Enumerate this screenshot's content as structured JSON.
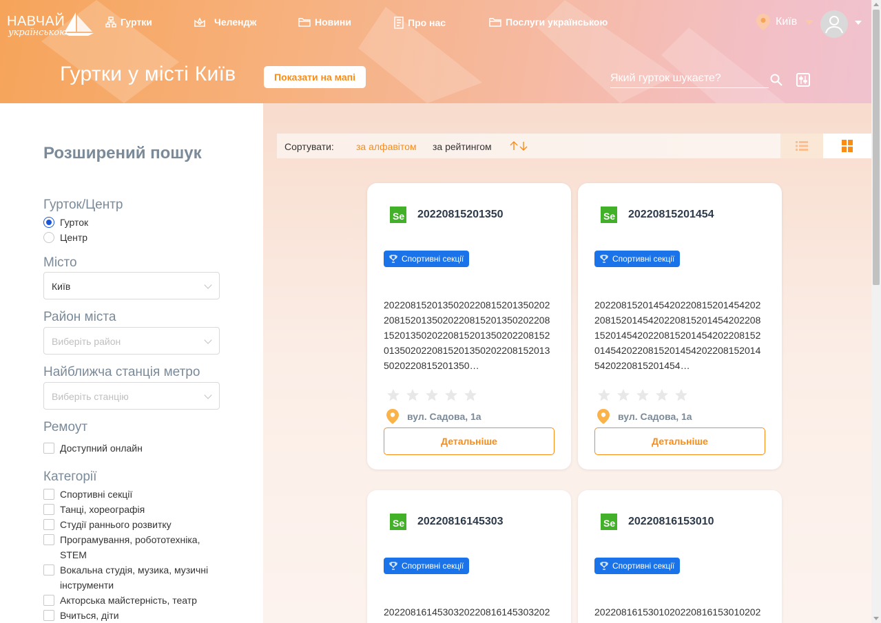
{
  "header": {
    "logo_main": "НАВЧАЙ",
    "logo_sub": "українською",
    "nav": [
      {
        "label": "Гуртки",
        "icon": "clubs-icon"
      },
      {
        "label": "Челендж",
        "icon": "challenge-icon"
      },
      {
        "label": "Новини",
        "icon": "news-folder-icon"
      },
      {
        "label": "Про нас",
        "icon": "about-icon"
      },
      {
        "label": "Послуги українською",
        "icon": "services-folder-icon"
      }
    ],
    "city": "Київ",
    "page_title": "Гуртки у місті Київ",
    "map_button": "Показати на мапі",
    "search_placeholder": "Який гурток шукаєте?"
  },
  "sidebar": {
    "title": "Розширений пошук",
    "type_label": "Гурток/Центр",
    "type_options": [
      "Гурток",
      "Центр"
    ],
    "type_selected": "Гурток",
    "city_label": "Місто",
    "city_value": "Київ",
    "district_label": "Район міста",
    "district_placeholder": "Виберіть район",
    "metro_label": "Найближча станція метро",
    "metro_placeholder": "Виберіть станцію",
    "remote_label": "Ремоут",
    "remote_option": "Доступний онлайн",
    "categories_label": "Категорії",
    "categories": [
      "Спортивні секції",
      "Танці, хореографія",
      "Студії раннього розвитку",
      "Програмування, робототехніка, STEM",
      "Вокальна студія, музика, музичні інструменти",
      "Акторська майстерність, театр",
      "Вчиться, діти"
    ]
  },
  "sortbar": {
    "label": "Сортувати:",
    "alpha": "за алфавітом",
    "rating": "за рейтингом"
  },
  "cards": [
    {
      "title": "20220815201350",
      "tag": "Спортивні секції",
      "desc": "20220815201350202208152013502022081520135020220815201350202208152013502022081520135020220815201350202208152013502022081520135020220815201350…",
      "address": "вул. Садова, 1а",
      "button": "Детальніше",
      "rating": 0
    },
    {
      "title": "20220815201454",
      "tag": "Спортивні секції",
      "desc": "20220815201454202208152014542022081520145420220815201454202208152014542022081520145420220815201454202208152014542022081520145420220815201454…",
      "address": "вул. Садова, 1а",
      "button": "Детальніше",
      "rating": 0
    },
    {
      "title": "20220816145303",
      "tag": "Спортивні секції",
      "desc": "20220816145303202208161453032022",
      "address": "",
      "button": "",
      "rating": 0
    },
    {
      "title": "20220816153010",
      "tag": "Спортивні секції",
      "desc": "20220816153010202208161530102022",
      "address": "",
      "button": "",
      "rating": 0
    }
  ],
  "colors": {
    "accent": "#fa8c16",
    "tag_blue": "#1a73e8",
    "label_gray": "#7a8a99"
  }
}
